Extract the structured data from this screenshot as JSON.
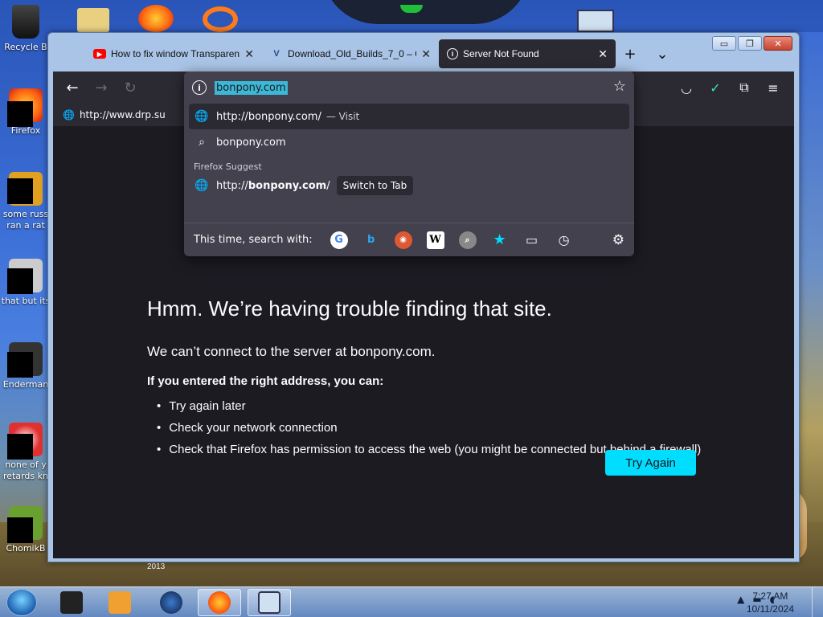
{
  "desktop": {
    "icons": [
      {
        "label": "Recycle B",
        "sub": ""
      },
      {
        "label": "Firefox",
        "sub": ""
      },
      {
        "label": "some russ",
        "sub": "ran a rat"
      },
      {
        "label": "that but its",
        "sub": ""
      },
      {
        "label": "Enderman",
        "sub": ""
      },
      {
        "label": "none of y",
        "sub": "retards kn"
      },
      {
        "label": "ChomikB",
        "sub": ""
      }
    ],
    "wallpaper_text": "2013"
  },
  "window": {
    "tabs": [
      {
        "title": "How to fix window Transparen",
        "icon": "youtube-icon",
        "active": false
      },
      {
        "title": "Download_Old_Builds_7_0 – O",
        "icon": "vk-icon",
        "active": false
      },
      {
        "title": "Server Not Found",
        "icon": "info-icon",
        "active": true
      }
    ],
    "new_tab": "+",
    "list_tabs": "⌄"
  },
  "urlbar": {
    "value": "bonpony.com",
    "suggestions": [
      {
        "text": "http://bonpony.com/",
        "action": "— Visit"
      },
      {
        "text": "bonpony.com"
      }
    ],
    "firefox_suggest_heading": "Firefox Suggest",
    "suggest_item": {
      "prefix": "http://",
      "bold": "bonpony.com",
      "suffix": "/",
      "action": "Switch to Tab"
    },
    "search_with_label": "This time, search with:"
  },
  "bookmarks": [
    {
      "label": "http://www.drp.su"
    }
  ],
  "error_page": {
    "title": "Hmm. We’re having trouble finding that site.",
    "subtitle": "We can’t connect to the server at bonpony.com.",
    "bold": "If you entered the right address, you can:",
    "items": [
      "Try again later",
      "Check your network connection",
      "Check that Firefox has permission to access the web (you might be connected but behind a firewall)"
    ],
    "button": "Try Again"
  },
  "taskbar": {
    "time": "7:27 AM",
    "date": "10/11/2024"
  },
  "colors": {
    "accent": "#00ddff",
    "browser_bg": "#1c1b22",
    "panel": "#42414d"
  }
}
